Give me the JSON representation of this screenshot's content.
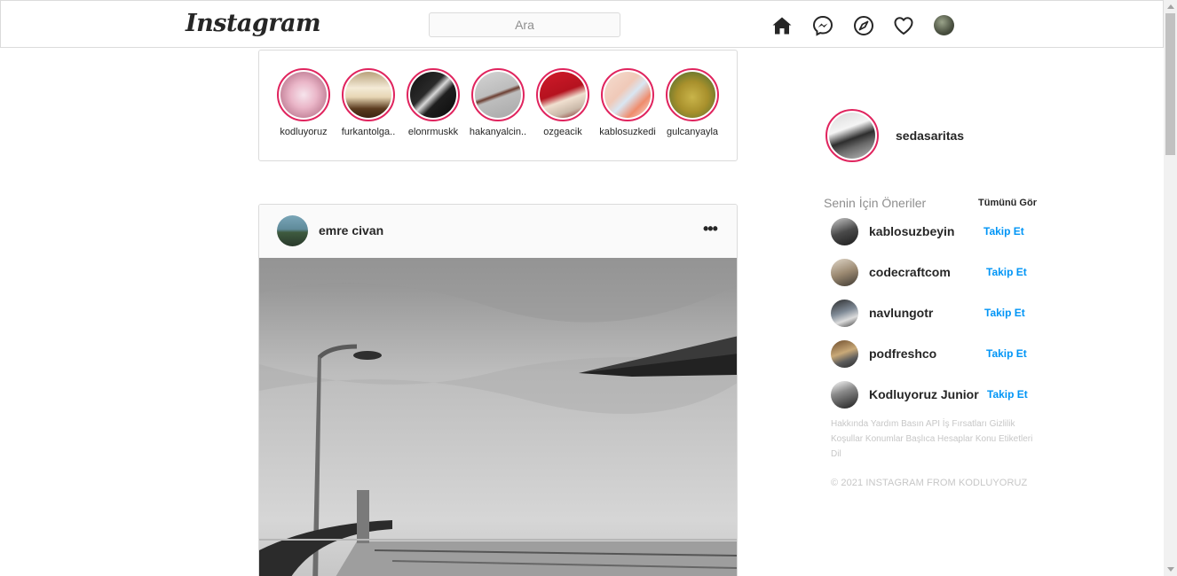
{
  "header": {
    "logo": "Instagram",
    "search_placeholder": "Ara",
    "icons": [
      "home-icon",
      "messenger-icon",
      "explore-icon",
      "heart-icon",
      "profile-avatar"
    ]
  },
  "stories": [
    {
      "username": "kodluyoruz"
    },
    {
      "username": "furkantolga.."
    },
    {
      "username": "elonrmuskk"
    },
    {
      "username": "hakanyalcin.."
    },
    {
      "username": "ozgeacik"
    },
    {
      "username": "kablosuzkedi"
    },
    {
      "username": "gulcanyayla"
    }
  ],
  "post": {
    "username": "emre civan",
    "more": "•••"
  },
  "sidebar": {
    "username": "sedasaritas",
    "suggestions_title": "Senin İçin Öneriler",
    "see_all": "Tümünü Gör",
    "suggestions": [
      {
        "username": "kablosuzbeyin",
        "action": "Takip Et"
      },
      {
        "username": "codecraftcom",
        "action": "Takip Et"
      },
      {
        "username": "navlungotr",
        "action": "Takip Et"
      },
      {
        "username": "podfreshco",
        "action": "Takip Et"
      },
      {
        "username": "Kodluyoruz Junior",
        "action": "Takip Et"
      }
    ],
    "footer_links": "Hakkında Yardım Basın API İş Fırsatları Gizlilik Koşullar Konumlar Başlıca Hesaplar Konu Etiketleri Dil",
    "copyright": "© 2021 INSTAGRAM FROM KODLUYORUZ"
  },
  "colors": {
    "story_ring": "#e0245e",
    "follow_link": "#0095f6",
    "border": "#dbdbdb"
  }
}
